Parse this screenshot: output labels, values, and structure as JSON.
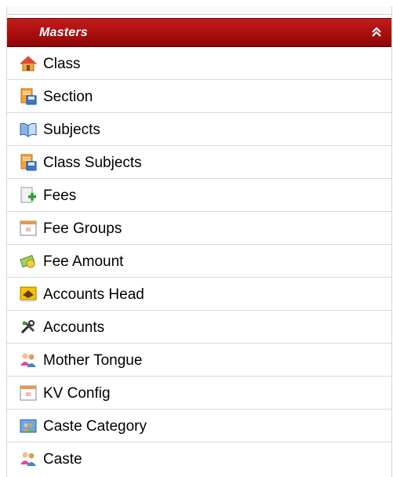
{
  "menu": {
    "title": "Masters",
    "collapse_icon": "double-chevron-up-icon",
    "items": [
      {
        "label": "Class",
        "icon": "house-icon"
      },
      {
        "label": "Section",
        "icon": "document-save-icon"
      },
      {
        "label": "Subjects",
        "icon": "open-book-icon"
      },
      {
        "label": "Class Subjects",
        "icon": "document-save-icon"
      },
      {
        "label": "Fees",
        "icon": "page-add-icon"
      },
      {
        "label": "Fee Groups",
        "icon": "calendar-window-icon"
      },
      {
        "label": "Fee Amount",
        "icon": "money-icon"
      },
      {
        "label": "Accounts Head",
        "icon": "ledger-book-icon"
      },
      {
        "label": "Accounts",
        "icon": "tools-icon"
      },
      {
        "label": "Mother Tongue",
        "icon": "people-icon"
      },
      {
        "label": "KV Config",
        "icon": "calendar-window-icon"
      },
      {
        "label": "Caste Category",
        "icon": "group-picture-icon"
      },
      {
        "label": "Caste",
        "icon": "people-icon"
      }
    ]
  },
  "colors": {
    "header_red": "#a80e0e",
    "divider": "#dadada"
  }
}
